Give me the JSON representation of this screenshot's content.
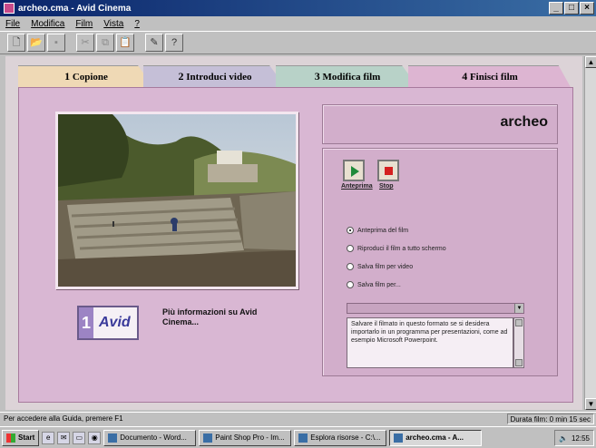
{
  "window": {
    "title": "archeo.cma - Avid Cinema",
    "min": "_",
    "max": "□",
    "close": "×"
  },
  "menu": [
    "File",
    "Modifica",
    "Film",
    "Vista",
    "?"
  ],
  "toolbar": {
    "icons": [
      "new-document-icon",
      "open-folder-icon",
      "save-icon",
      "cut-icon",
      "copy-icon",
      "paste-icon",
      "pin-icon",
      "help-icon"
    ],
    "help_glyph": "?"
  },
  "tabs": [
    {
      "num": "1",
      "label": "Copione"
    },
    {
      "num": "2",
      "label": "Introduci video"
    },
    {
      "num": "3",
      "label": "Modifica film"
    },
    {
      "num": "4",
      "label": "Finisci film"
    }
  ],
  "project_name": "archeo",
  "avid_logo": {
    "num": "1",
    "word": "Avid"
  },
  "more_info": "Più informazioni su Avid Cinema...",
  "buttons": {
    "play": "Anteprima",
    "stop": "Stop"
  },
  "options": [
    {
      "label": "Anteprima del film",
      "selected": true
    },
    {
      "label": "Riproduci il film a tutto schermo",
      "selected": false
    },
    {
      "label": "Salva film per video",
      "selected": false
    },
    {
      "label": "Salva film per...",
      "selected": false
    }
  ],
  "dropdown": {
    "value": "",
    "caret": "▼"
  },
  "description": "Salvare il filmato in questo formato se si desidera importarlo in un programma per presentazioni, come ad esempio Microsoft Powerpoint.",
  "status": {
    "left": "Per accedere alla Guida, premere F1",
    "right": "Durata film: 0 min 15 sec"
  },
  "taskbar": {
    "start": "Start",
    "tasks": [
      {
        "label": "Documento - Word...",
        "active": false
      },
      {
        "label": "Paint Shop Pro - Im...",
        "active": false
      },
      {
        "label": "Esplora risorse - C:\\...",
        "active": false
      },
      {
        "label": "archeo.cma - A...",
        "active": true
      }
    ],
    "clock": "12:55"
  },
  "colors": {
    "titlebar": "#0a246a",
    "panel": "#d9b7d3",
    "tab1": "#efd9b5",
    "tab2": "#c5bfd7",
    "tab3": "#b8d2c8",
    "tab4": "#ddb5d2"
  }
}
